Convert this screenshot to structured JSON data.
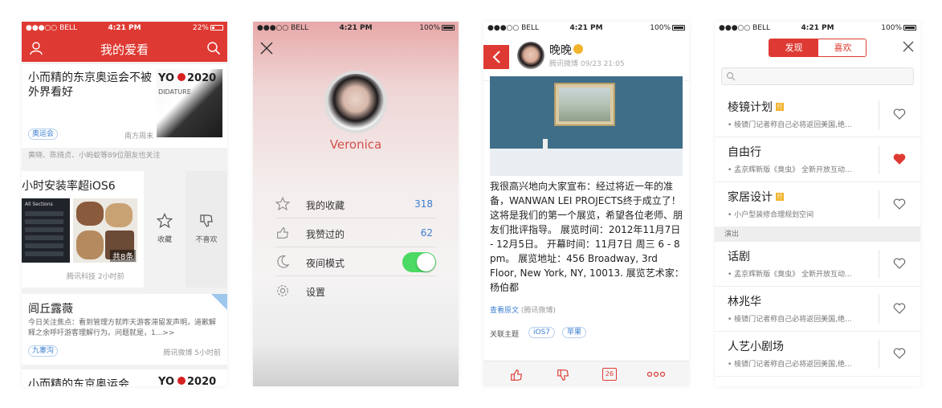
{
  "status": {
    "carrier": "●●●○○ BELL",
    "time": "4:21 PM",
    "battery_p1": "22%",
    "battery_full": "100%"
  },
  "feed": {
    "title": "我的爱看",
    "cards": [
      {
        "headline": "小而精的东京奥运会不被外界看好",
        "tag": "奥运会",
        "source": "南方周末",
        "friends": "黄晓、陈绮贞、小蚂蚁等89位朋友也关注",
        "thumb_text": "YO",
        "thumb_year": "2020",
        "thumb_sub": "DIDATURE"
      },
      {
        "headline": "小时安装率超iOS6",
        "count": "共8条",
        "source": "腾讯科技 2小时前",
        "shot_header": "All Sections"
      },
      {
        "headline": "闾丘露薇",
        "summary": "今日关注焦点：看到管理方就昨天游客滞留发声明，道歉解释之余呼吁游客理解行为。问题就是，1...>>",
        "tag": "九寨沟",
        "source": "腾讯微博 5小时前"
      },
      {
        "headline": "小而精的东京奥运会"
      }
    ],
    "swipe_actions": [
      {
        "label": "收藏",
        "icon": "star-icon"
      },
      {
        "label": "不喜欢",
        "icon": "thumbs-down-icon"
      }
    ]
  },
  "profile": {
    "name": "Veronica",
    "menu": [
      {
        "label": "我的收藏",
        "value": "318",
        "icon": "star-icon"
      },
      {
        "label": "我赞过的",
        "value": "62",
        "icon": "thumbs-up-icon"
      },
      {
        "label": "夜间模式",
        "value": "",
        "icon": "moon-icon"
      },
      {
        "label": "设置",
        "value": "",
        "icon": "gear-icon"
      }
    ],
    "night_mode_on": true
  },
  "post": {
    "author": "晚晚",
    "meta": "腾讯微博 09/23  21:05",
    "body": "我很高兴地向大家宣布：经过将近一年的准备，WANWAN LEI PROJECTS终于成立了！ 这将是我们的第一个展览，希望各位老师、朋友们批评指导。 展览时间：2012年11月7日 - 12月5日。 开幕时间：11月7日 周三 6 - 8 pm。 展览地址：456 Broadway, 3rd Floor, New York, NY, 10013. 展览艺术家：杨伯都",
    "original_link": "查看原文",
    "original_src": "(腾讯微博)",
    "topics_label": "关联主题",
    "topics": [
      "iOS7",
      "苹果"
    ],
    "comment_count": "26"
  },
  "discover": {
    "tabs": [
      "发现",
      "喜欢"
    ],
    "items": [
      {
        "name": "棱镜计划",
        "badge": "行",
        "desc": "• 棱镜门记者称自己必将返回美国,绝...",
        "liked": false
      },
      {
        "name": "自由行",
        "badge": "",
        "desc": "• 孟京辉新版《臭虫》 全新开放互动...",
        "liked": true
      },
      {
        "name": "家居设计",
        "badge": "行",
        "desc": "• 小户型装修合理规划空间",
        "liked": false
      }
    ],
    "section": "演出",
    "items2": [
      {
        "name": "话剧",
        "desc": "• 孟京辉新版《臭虫》 全新开放互动...",
        "liked": false
      },
      {
        "name": "林兆华",
        "desc": "• 棱镜门记者称自己必将返回美国,绝...",
        "liked": false
      },
      {
        "name": "人艺小剧场",
        "desc": "• 棱镜门记者称自己必将返回美国,绝...",
        "liked": false
      }
    ]
  },
  "colors": {
    "accent": "#de3a33",
    "link": "#3b7ed1",
    "toggle": "#4cd964",
    "badge": "#f2b32c"
  }
}
